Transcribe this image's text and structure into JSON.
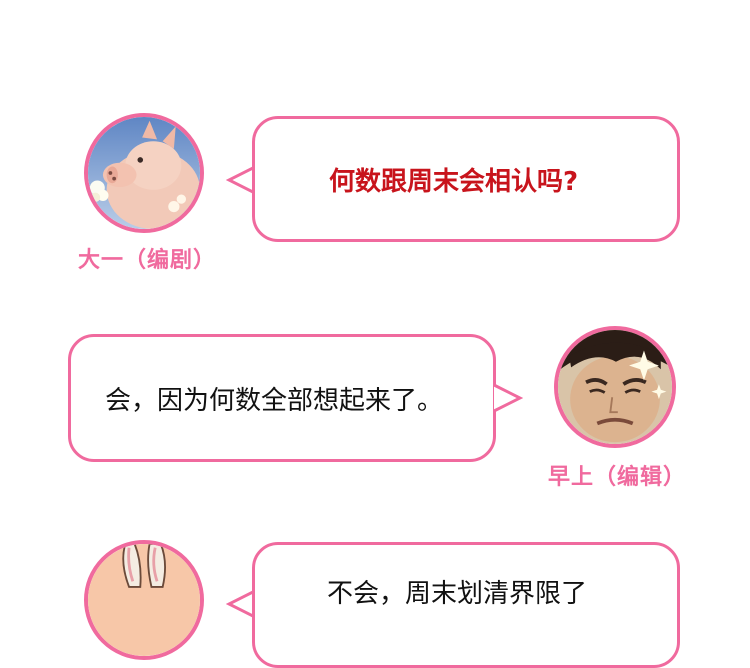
{
  "messages": [
    {
      "speaker": "大一（编剧）",
      "text": "何数跟周末会相认吗?",
      "text_color": "#c8141c",
      "avatar": "pig-avatar"
    },
    {
      "speaker": "早上（编辑）",
      "text": "会，因为何数全部想起来了。",
      "text_color": "#111111",
      "avatar": "crying-man-avatar"
    },
    {
      "speaker": "",
      "text": "不会，周末划清界限了",
      "text_color": "#111111",
      "avatar": "rabbit-avatar"
    }
  ],
  "colors": {
    "accent": "#f06a9e"
  }
}
